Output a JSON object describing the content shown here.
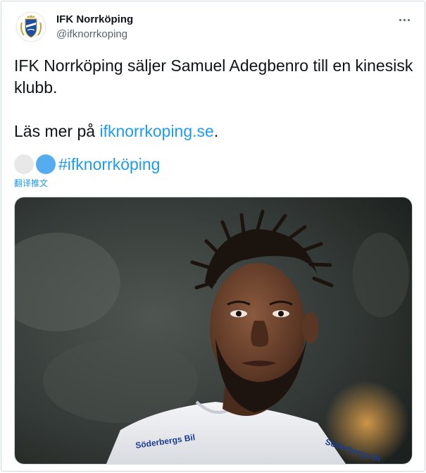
{
  "tweet": {
    "display_name": "IFK Norrköping",
    "handle": "@ifknorrkoping",
    "text_line1": "IFK Norrköping säljer Samuel Adegbenro till en kinesisk klubb.",
    "text_line2_prefix": "Läs mer på ",
    "link_text": "ifknorrkoping.se",
    "text_line2_suffix": ".",
    "hashtag": "#ifknorrköping",
    "translate_label": "翻译推文",
    "emoji_icons": [
      "white-circle-icon",
      "blue-circle-icon"
    ],
    "image": {
      "jersey_text": "Söderbergs Bil",
      "jersey_text_right": "Söderbergs Bi"
    }
  },
  "colors": {
    "link": "#1d9bf0",
    "text": "#0f1419",
    "secondary": "#536471",
    "border": "#cfd9de"
  }
}
